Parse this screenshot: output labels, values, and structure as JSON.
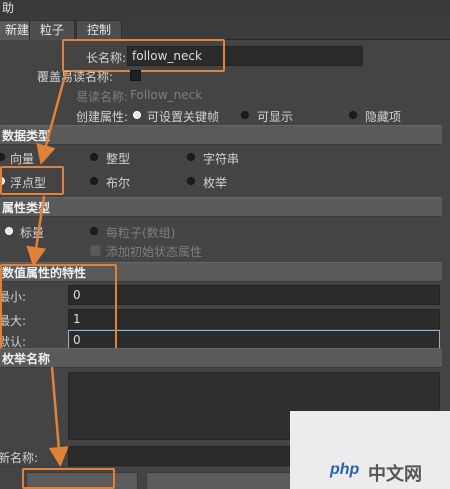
{
  "window": {
    "title": "助"
  },
  "tabs": [
    {
      "label": "新建"
    },
    {
      "label": "粒子"
    },
    {
      "label": "控制"
    }
  ],
  "names": {
    "long_name_label": "长名称:",
    "long_name_value": "follow_neck",
    "override_nice_label": "覆盖易读名称:",
    "nice_name_label": "易读名称:",
    "nice_name_value": "Follow_neck",
    "create_attr_label": "创建属性:",
    "create_attr_options": [
      "可设置关键帧",
      "可显示",
      "隐藏项"
    ]
  },
  "data_type": {
    "header": "数据类型",
    "options": [
      "向量",
      "整型",
      "字符串",
      "浮点型",
      "布尔",
      "枚举"
    ],
    "selected": "浮点型"
  },
  "attr_type": {
    "header": "属性类型",
    "scalar_label": "标量",
    "per_particle_label": "每粒子(数组)",
    "add_initial_state_label": "添加初始状态属性"
  },
  "numeric": {
    "header": "数值属性的特性",
    "min_label": "最小:",
    "min_value": "0",
    "max_label": "最大:",
    "max_value": "1",
    "default_label": "默认:",
    "default_value": "0"
  },
  "enum": {
    "header": "枚举名称",
    "new_name_label": "新名称:"
  },
  "watermark": {
    "logo": "php",
    "text": "中文网"
  },
  "colors": {
    "highlight": "#e0823a",
    "panel": "#444444",
    "field": "#2b2b2b",
    "section": "#5a5a5a"
  }
}
